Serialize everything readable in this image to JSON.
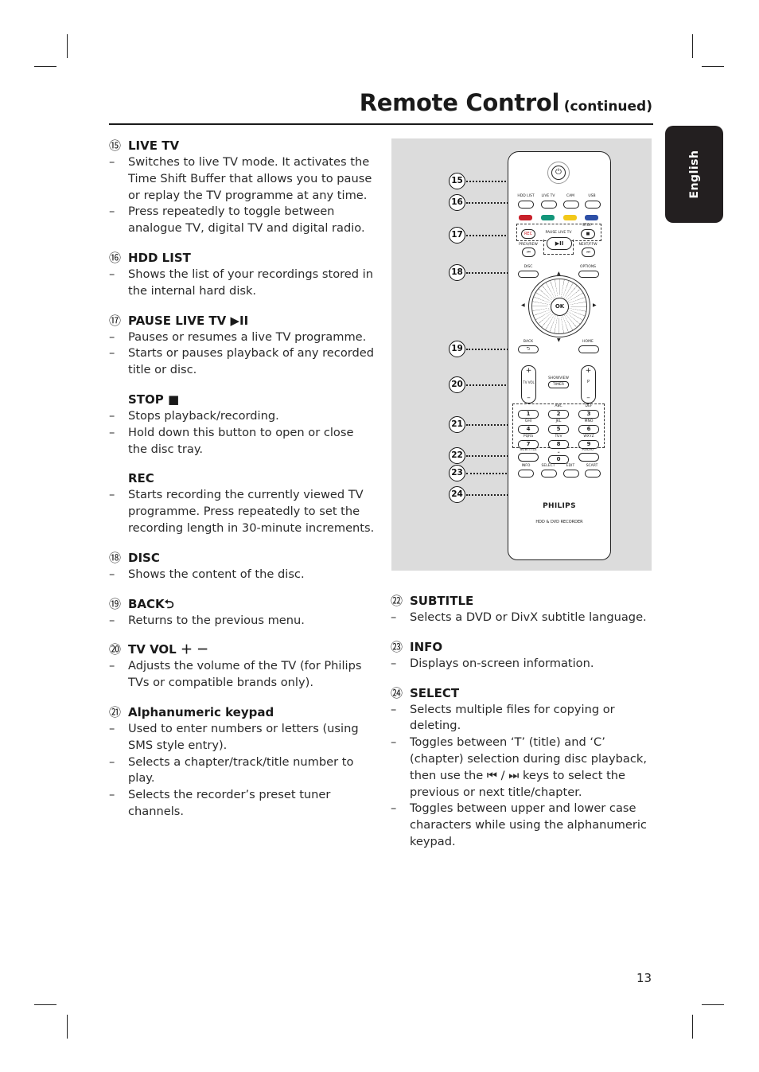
{
  "header": {
    "title": "Remote Control",
    "continued": "(continued)"
  },
  "language_tab": "English",
  "page_number": "13",
  "left_column": [
    {
      "num": "⑮",
      "heading": "LIVE TV",
      "items": [
        "Switches to live TV mode.  It activates the Time Shift Buffer that allows you to pause or replay the  TV programme at any time.",
        "Press repeatedly to toggle between analogue TV, digital TV and digital radio."
      ]
    },
    {
      "num": "⑯",
      "heading": "HDD LIST",
      "items": [
        "Shows the list of your recordings stored in the internal hard disk."
      ]
    },
    {
      "num": "⑰",
      "heading": "PAUSE LIVE TV ▶II",
      "items": [
        "Pauses or resumes a live TV programme.",
        "Starts or pauses playback of any recorded title or disc."
      ]
    },
    {
      "num": "",
      "heading": "STOP ■",
      "items": [
        "Stops playback/recording.",
        "Hold down this button to open or close the disc tray."
      ]
    },
    {
      "num": "",
      "heading": "REC",
      "items": [
        "Starts recording the currently viewed TV programme. Press repeatedly to set the recording length in 30-minute increments."
      ]
    },
    {
      "num": "⑱",
      "heading": "DISC",
      "items": [
        "Shows the content of the disc."
      ]
    },
    {
      "num": "⑲",
      "heading": "BACK⮌",
      "items": [
        "Returns to the previous menu."
      ]
    },
    {
      "num": "⑳",
      "heading": "TV VOL ＋ －",
      "items": [
        "Adjusts the volume of the TV (for Philips TVs or compatible brands only)."
      ]
    },
    {
      "num": "㉑",
      "heading": "Alphanumeric keypad",
      "items": [
        "Used to enter numbers or letters (using SMS style entry).",
        "Selects a chapter/track/title number to play.",
        "Selects the recorder’s preset tuner channels."
      ]
    }
  ],
  "right_column": [
    {
      "num": "㉒",
      "heading": "SUBTITLE",
      "items": [
        "Selects a DVD or DivX subtitle language."
      ]
    },
    {
      "num": "㉓",
      "heading": "INFO",
      "items": [
        "Displays on-screen information."
      ]
    },
    {
      "num": "㉔",
      "heading": "SELECT",
      "items": [
        "Selects multiple files for copying or deleting.",
        "Toggles between ‘T’ (title) and ‘C’ (chapter) selection during disc playback, then use the ⏮ / ⏭ keys to select the previous or next title/chapter.",
        "Toggles between upper and lower case characters while using the alphanumeric keypad."
      ]
    }
  ],
  "figure": {
    "callouts": [
      "15",
      "16",
      "17",
      "18",
      "19",
      "20",
      "21",
      "22",
      "23",
      "24"
    ],
    "remote": {
      "power_symbol": "⏻",
      "top_row": [
        "HDD LIST",
        "LIVE TV",
        "CAM",
        "USB"
      ],
      "color_keys": [
        "#c8202a",
        "#13967a",
        "#f2c81a",
        "#2d4fa6"
      ],
      "transport": {
        "rec": "REC",
        "rec_color": "#d0202a",
        "pause_live_tv": "PAUSE LIVE TV",
        "play_pause": "▶II",
        "stop": "STOP",
        "stop_symbol": "■",
        "prev": "PREV/REW",
        "prev_symbol": "⏮",
        "next": "NEXT/FFW",
        "next_symbol": "⏭"
      },
      "disc": "DISC",
      "options": "OPTIONS",
      "ok": "OK",
      "back": "BACK",
      "back_symbol": "⮌",
      "home": "HOME",
      "tv_vol": "TV VOL",
      "program": "P",
      "showview": "SHOWVIEW",
      "timer": "TIMER",
      "keypad": [
        {
          "digit": "1",
          "letters": ""
        },
        {
          "digit": "2",
          "letters": "ABC"
        },
        {
          "digit": "3",
          "letters": "DEF"
        },
        {
          "digit": "4",
          "letters": "GHI"
        },
        {
          "digit": "5",
          "letters": "JKL"
        },
        {
          "digit": "6",
          "letters": "MNO"
        },
        {
          "digit": "7",
          "letters": "PQRS"
        },
        {
          "digit": "8",
          "letters": "TUV"
        },
        {
          "digit": "9",
          "letters": "WXYZ"
        },
        {
          "digit": "0",
          "letters": "␣"
        }
      ],
      "subtitle": "SUBTITLE",
      "audio": "AUDIO",
      "bottom_row": [
        "INFO",
        "SELECT",
        "EDIT",
        "SCART"
      ],
      "brand": "PHILIPS",
      "model": "HDD & DVD RECORDER"
    }
  }
}
